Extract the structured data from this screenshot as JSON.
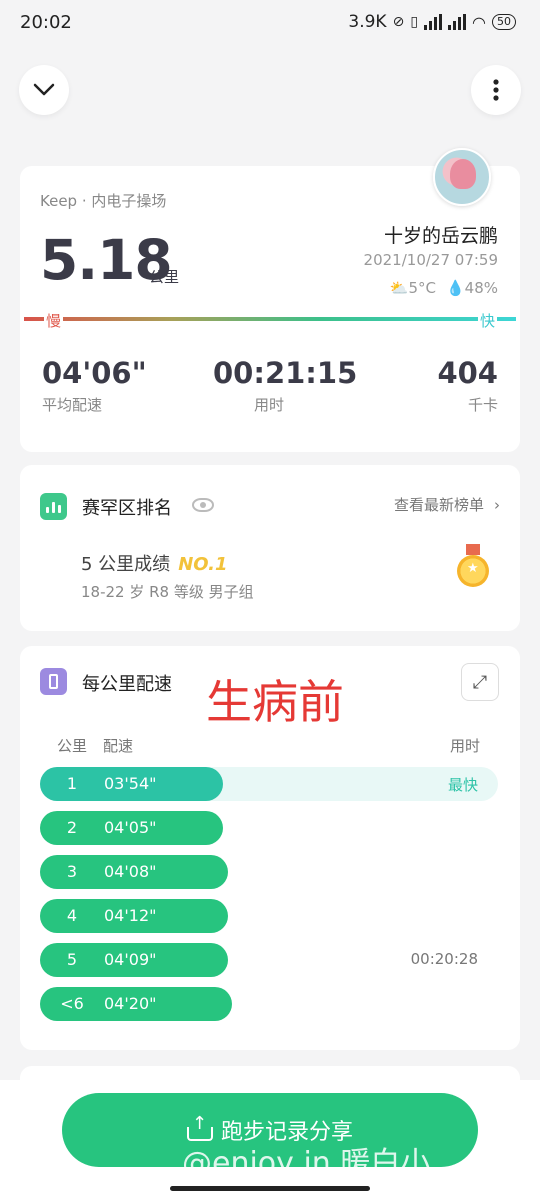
{
  "status_bar": {
    "time": "20:02",
    "net_speed": "3.9K",
    "battery": "50"
  },
  "summary": {
    "source": "Keep · 内电子操场",
    "distance": "5.18",
    "distance_unit": "公里",
    "username": "十岁的岳云鹏",
    "datetime": "2021/10/27 07:59",
    "temperature": "5°C",
    "humidity": "48%",
    "slow_label": "慢",
    "fast_label": "快",
    "stats": [
      {
        "value": "04'06\"",
        "label": "平均配速"
      },
      {
        "value": "00:21:15",
        "label": "用时"
      },
      {
        "value": "404",
        "label": "千卡"
      }
    ]
  },
  "ranking": {
    "title": "赛罕区排名",
    "link": "查看最新榜单",
    "score_text": "5 公里成绩",
    "badge": "NO.1",
    "group": "18-22 岁 R8 等级 男子组"
  },
  "splits": {
    "title": "每公里配速",
    "overlay_text": "生病前",
    "headers": {
      "km": "公里",
      "pace": "配速",
      "time": "用时"
    },
    "fastest_label": "最快",
    "rows": [
      {
        "km": "1",
        "pace": "03'54\"",
        "fraction": 0.4,
        "fastest": true,
        "time": ""
      },
      {
        "km": "2",
        "pace": "04'05\"",
        "fraction": 0.4,
        "fastest": false,
        "time": ""
      },
      {
        "km": "3",
        "pace": "04'08\"",
        "fraction": 0.41,
        "fastest": false,
        "time": ""
      },
      {
        "km": "4",
        "pace": "04'12\"",
        "fraction": 0.41,
        "fastest": false,
        "time": ""
      },
      {
        "km": "5",
        "pace": "04'09\"",
        "fraction": 0.41,
        "fastest": false,
        "time": "00:20:28"
      },
      {
        "km": "<6",
        "pace": "04'20\"",
        "fraction": 0.42,
        "fastest": false,
        "time": ""
      }
    ]
  },
  "share": {
    "label": "跑步记录分享",
    "watermark": "@enjoy in 暖白小"
  },
  "colors": {
    "accent_green": "#27c47f",
    "fastest_track": "#e8f8f6",
    "fastest_fill": "#2cc3a5"
  }
}
